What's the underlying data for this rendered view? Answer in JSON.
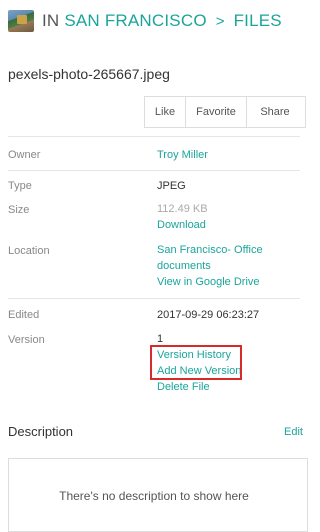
{
  "header": {
    "prefix": "IN",
    "location": "SAN FRANCISCO",
    "separator": ">",
    "section": "FILES",
    "thumbnail_icon": "image-thumbnail"
  },
  "file": {
    "name": "pexels-photo-265667.jpeg"
  },
  "actions": {
    "like": "Like",
    "favorite": "Favorite",
    "share": "Share"
  },
  "details": {
    "owner_label": "Owner",
    "owner_value": "Troy Miller",
    "type_label": "Type",
    "type_value": "JPEG",
    "size_label": "Size",
    "size_value": "112.49 KB",
    "download": "Download",
    "location_label": "Location",
    "location_lines": [
      "San Francisco- Office",
      "documents"
    ],
    "view_in_drive": "View in Google Drive",
    "edited_label": "Edited",
    "edited_value": "2017-09-29 06:23:27",
    "version_label": "Version",
    "version_value": "1",
    "version_history": "Version History",
    "add_new_version": "Add New Version",
    "delete_file": "Delete File"
  },
  "description": {
    "title": "Description",
    "edit": "Edit",
    "empty": "There's no description to show here"
  },
  "colors": {
    "accent": "#1aa59b",
    "highlight": "#d72a2a"
  }
}
